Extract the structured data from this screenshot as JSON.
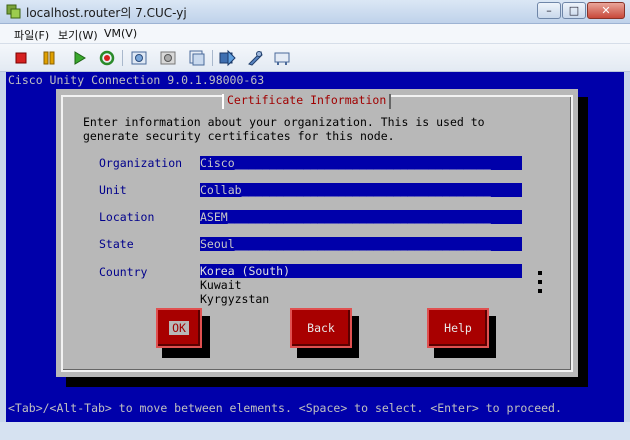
{
  "window": {
    "title": "localhost.router의 7.CUC-yj",
    "minimize_label": "–",
    "maximize_label": "□",
    "close_label": "✕"
  },
  "menubar": {
    "items": [
      {
        "label": "파일(F)"
      },
      {
        "label": "보기(W)"
      },
      {
        "label": "VM(V)"
      }
    ]
  },
  "toolbar": {
    "icons": [
      "stop-icon",
      "pause-icon",
      "play-icon",
      "reset-icon",
      "snapshot-icon",
      "revert-snapshot-icon",
      "snapshot-manager-icon",
      "send-input-icon",
      "settings-icon",
      "network-icon"
    ]
  },
  "console": {
    "header": "Cisco Unity Connection 9.0.1.98000-63",
    "footer": "<Tab>/<Alt-Tab> to move between elements. <Space> to select. <Enter> to proceed.",
    "colors": {
      "background": "#0000aa",
      "dialog": "#b8b8b8",
      "button": "#a80000",
      "label": "#00008b"
    }
  },
  "dialog": {
    "title": "Certificate Information",
    "intro_line1": "Enter information about your organization. This is used to",
    "intro_line2": "generate security certificates for this node.",
    "fields": [
      {
        "label": "Organization",
        "value": "Cisco_____________________________________"
      },
      {
        "label": "Unit",
        "value": "Collab____________________________________"
      },
      {
        "label": "Location",
        "value": "ASEM______________________________________"
      },
      {
        "label": "State",
        "value": "Seoul_____________________________________"
      }
    ],
    "country": {
      "label": "Country",
      "options": [
        "Korea (South)",
        "Kuwait",
        "Kyrgyzstan"
      ],
      "selected": "Korea (South)"
    },
    "buttons": {
      "ok": "OK",
      "back": "Back",
      "help": "Help"
    }
  }
}
